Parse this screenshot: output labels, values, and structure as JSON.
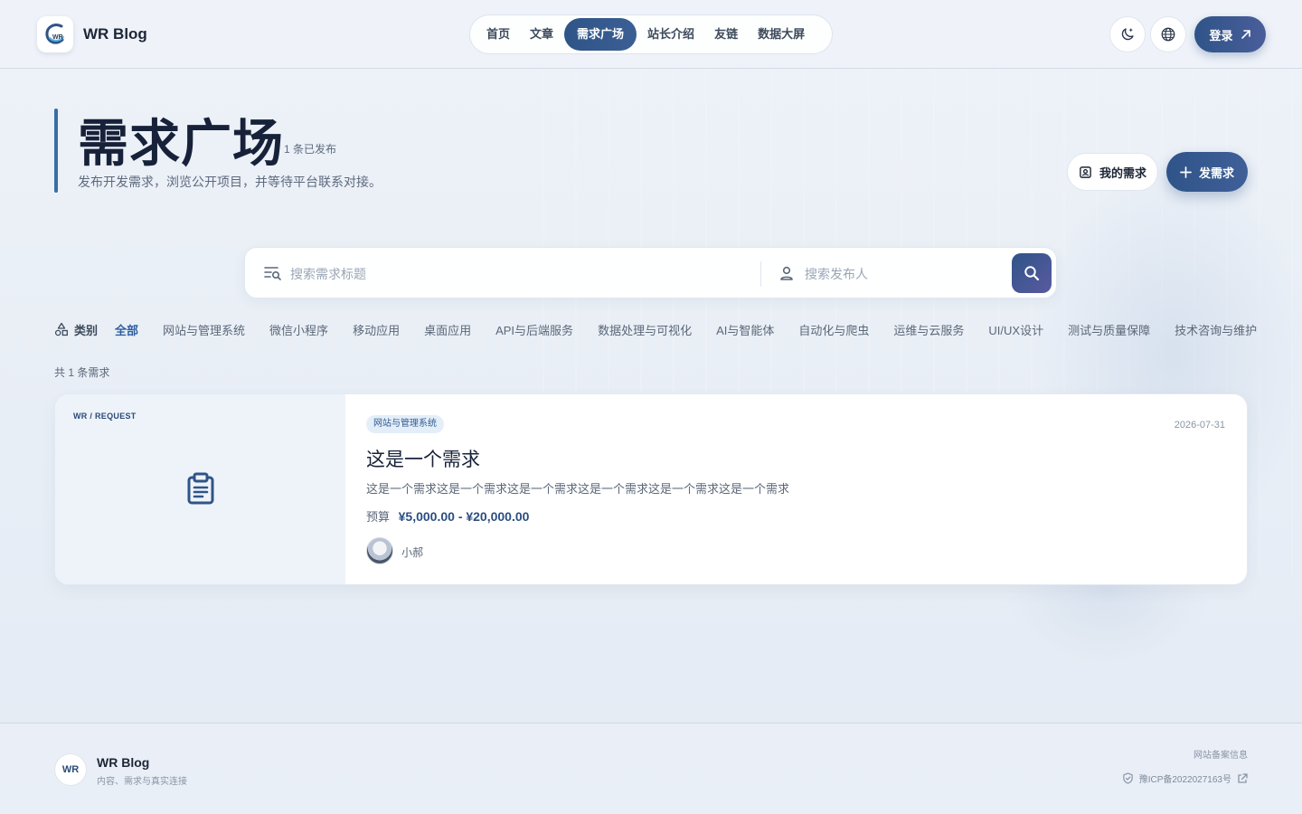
{
  "header": {
    "brand": "WR Blog",
    "logo_text": "WR",
    "nav": [
      {
        "label": "首页",
        "active": false
      },
      {
        "label": "文章",
        "active": false
      },
      {
        "label": "需求广场",
        "active": true
      },
      {
        "label": "站长介绍",
        "active": false
      },
      {
        "label": "友链",
        "active": false
      },
      {
        "label": "数据大屏",
        "active": false
      }
    ],
    "theme_icon": "moon-icon",
    "language_icon": "globe-icon",
    "login_label": "登录",
    "login_icon": "arrow-up-right-icon"
  },
  "hero": {
    "title": "需求广场",
    "count_text": "1 条已发布",
    "subtitle": "发布开发需求，浏览公开项目，并等待平台联系对接。",
    "my_requests_label": "我的需求",
    "post_label": "发需求"
  },
  "search": {
    "title_placeholder": "搜索需求标题",
    "title_value": "",
    "publisher_placeholder": "搜索发布人",
    "publisher_value": ""
  },
  "categories": {
    "label": "类别",
    "items": [
      {
        "label": "全部",
        "active": true
      },
      {
        "label": "网站与管理系统",
        "active": false
      },
      {
        "label": "微信小程序",
        "active": false
      },
      {
        "label": "移动应用",
        "active": false
      },
      {
        "label": "桌面应用",
        "active": false
      },
      {
        "label": "API与后端服务",
        "active": false
      },
      {
        "label": "数据处理与可视化",
        "active": false
      },
      {
        "label": "AI与智能体",
        "active": false
      },
      {
        "label": "自动化与爬虫",
        "active": false
      },
      {
        "label": "运维与云服务",
        "active": false
      },
      {
        "label": "UI/UX设计",
        "active": false
      },
      {
        "label": "测试与质量保障",
        "active": false
      },
      {
        "label": "技术咨询与维护",
        "active": false
      }
    ]
  },
  "total_text": "共 1 条需求",
  "requests": [
    {
      "cover_tag": "WR / REQUEST",
      "cover_icon": "clipboard-icon",
      "category": "网站与管理系统",
      "date": "2026-07-31",
      "title": "这是一个需求",
      "description": "这是一个需求这是一个需求这是一个需求这是一个需求这是一个需求这是一个需求",
      "budget_label": "预算",
      "budget_value": "¥5,000.00 - ¥20,000.00",
      "author": "小郝"
    }
  ],
  "footer": {
    "logo_text": "WR",
    "name": "WR Blog",
    "tagline": "内容、需求与真实连接",
    "record_label": "网站备案信息",
    "icp": "豫ICP备2022027163号"
  },
  "colors": {
    "accent": "#2f5488",
    "active_category": "#2f5ea0",
    "background": "#eef2f8"
  }
}
